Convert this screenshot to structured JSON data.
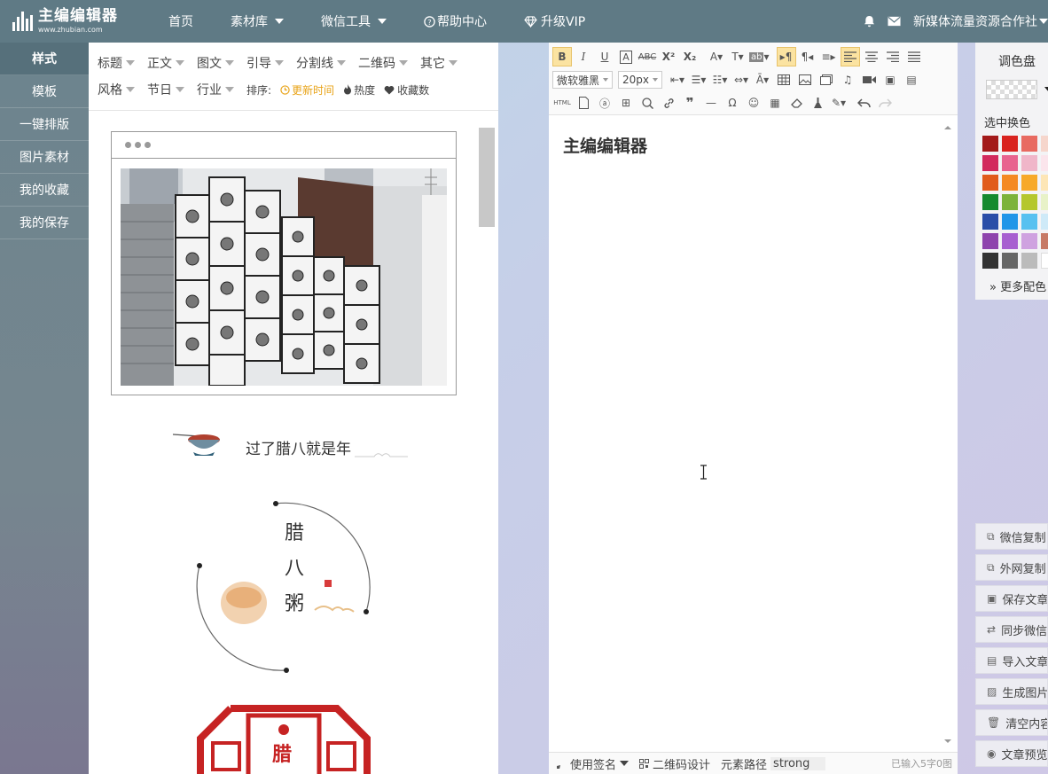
{
  "logo": {
    "main": "主编编辑器",
    "sub": "www.zhubian.com"
  },
  "nav": [
    {
      "label": "首页",
      "dropdown": false,
      "icon": ""
    },
    {
      "label": "素材库",
      "dropdown": true,
      "icon": ""
    },
    {
      "label": "微信工具",
      "dropdown": true,
      "icon": ""
    },
    {
      "label": "帮助中心",
      "dropdown": false,
      "icon": "help-icon"
    },
    {
      "label": "升级VIP",
      "dropdown": false,
      "icon": "diamond-icon"
    }
  ],
  "topRight": {
    "user": "新媒体流量资源合作社"
  },
  "sidebar": [
    "样式",
    "模板",
    "一键排版",
    "图片素材",
    "我的收藏",
    "我的保存"
  ],
  "filters": {
    "row1": [
      "标题",
      "正文",
      "图文",
      "引导",
      "分割线",
      "二维码",
      "其它"
    ],
    "row2": [
      "风格",
      "节日",
      "行业"
    ],
    "sortLabel": "排序:",
    "sorts": [
      {
        "label": "更新时间",
        "active": true
      },
      {
        "label": "热度",
        "active": false
      },
      {
        "label": "收藏数",
        "active": false
      }
    ]
  },
  "templates": {
    "card2Text": "过了腊八就是年",
    "card3Chars": [
      "腊",
      "八",
      "粥"
    ],
    "card4Char": "腊"
  },
  "editor": {
    "fontFamily": "微软雅黑",
    "fontSize": "20px",
    "htmlLabel": "HTML",
    "contentTitle": "主编编辑器",
    "status": {
      "sign": "使用签名",
      "qr": "二维码设计",
      "pathLabel": "元素路径",
      "pathValue": "strong",
      "count": "已输入5字0图"
    }
  },
  "palette": {
    "title": "调色盘",
    "pickLabel": "选中换色",
    "more": "更多配色",
    "colors": [
      "#a31a1a",
      "#d9231f",
      "#e86a61",
      "#f6d6cc",
      "#d22a5d",
      "#e8638f",
      "#f0b6c9",
      "#fbe5ec",
      "#e15b1c",
      "#f48923",
      "#f7a928",
      "#fde6b6",
      "#158a2f",
      "#7cb33b",
      "#b5c72d",
      "#e8f2c8",
      "#2a4ea8",
      "#2196e8",
      "#57c1f0",
      "#cfeaf8",
      "#8e44ad",
      "#a75fd0",
      "#cfa2e0",
      "#c77a66",
      "#333333",
      "#666666",
      "#bbbbbb",
      "#ffffff"
    ]
  },
  "actions": [
    "微信复制",
    "外网复制",
    "保存文章",
    "同步微信",
    "导入文章",
    "生成图片",
    "清空内容",
    "文章预览"
  ]
}
